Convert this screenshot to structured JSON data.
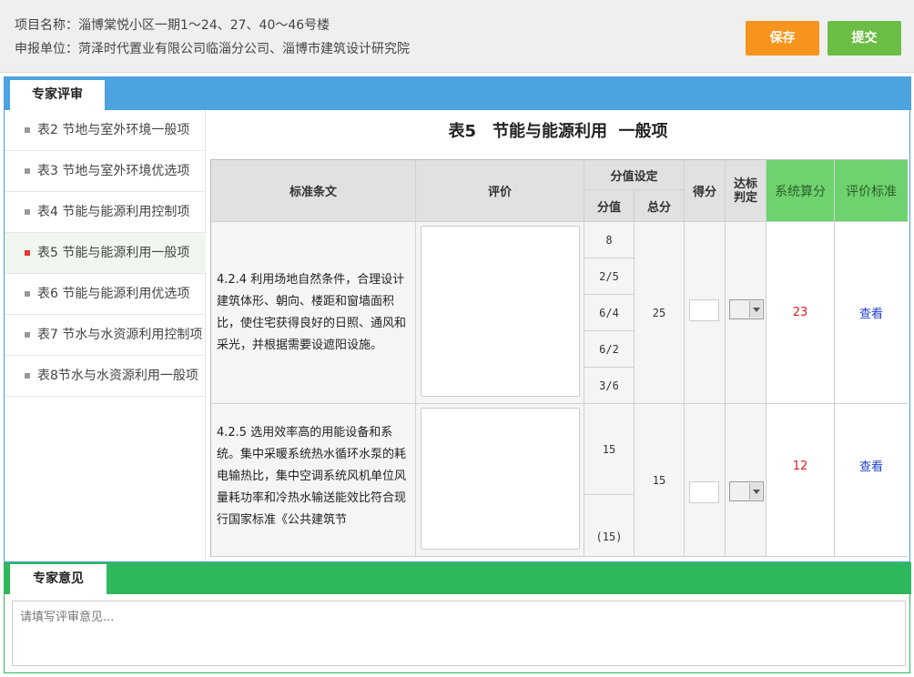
{
  "header": {
    "project_line": "项目名称：淄博棠悦小区一期1～24、27、40～46号楼",
    "unit_line": "申报单位：菏泽时代置业有限公司临淄分公司、淄博市建筑设计研究院",
    "save_label": "保存",
    "submit_label": "提交"
  },
  "review": {
    "tab_label": "专家评审"
  },
  "sidebar": {
    "items": [
      {
        "label": "表2 节地与室外环境一般项",
        "active": false
      },
      {
        "label": "表3 节地与室外环境优选项",
        "active": false
      },
      {
        "label": "表4 节能与能源利用控制项",
        "active": false
      },
      {
        "label": "表5 节能与能源利用一般项",
        "active": true
      },
      {
        "label": "表6 节能与能源利用优选项",
        "active": false
      },
      {
        "label": "表7 节水与水资源利用控制项",
        "active": false
      },
      {
        "label": "表8节水与水资源利用一般项",
        "active": false
      }
    ]
  },
  "table": {
    "title": "表5　节能与能源利用  一般项",
    "headers": {
      "clause": "标准条文",
      "evaluation": "评价",
      "score_setting": "分值设定",
      "score_value": "分值",
      "total": "总分",
      "score": "得分",
      "judge": "达标判定",
      "system_score": "系统算分",
      "criteria": "评价标准"
    },
    "rows": [
      {
        "clause": "4.2.4 利用场地自然条件，合理设计建筑体形、朝向、楼距和窗墙面积比，使住宅获得良好的日照、通风和采光，并根据需要设遮阳设施。",
        "values": [
          "8",
          "2/5",
          "6/4",
          "6/2",
          "3/6"
        ],
        "total": "25",
        "system_score": "23",
        "criteria_link": "查看"
      },
      {
        "clause": "4.2.5 选用效率高的用能设备和系统。集中采暖系统热水循环水泵的耗电输热比，集中空调系统风机单位风量耗功率和冷热水输送能效比符合现行国家标准《公共建筑节",
        "values": [
          "15",
          "(15)"
        ],
        "total": "15",
        "system_score": "12",
        "criteria_link": "查看"
      }
    ]
  },
  "opinion": {
    "tab_label": "专家意见",
    "placeholder": "请填写评审意见..."
  },
  "colors": {
    "save": "#f7941d",
    "submit": "#6cbd45",
    "review_bar": "#4ca3e0",
    "opinion_bar": "#2eb85c",
    "header_green": "#6ed36e"
  }
}
